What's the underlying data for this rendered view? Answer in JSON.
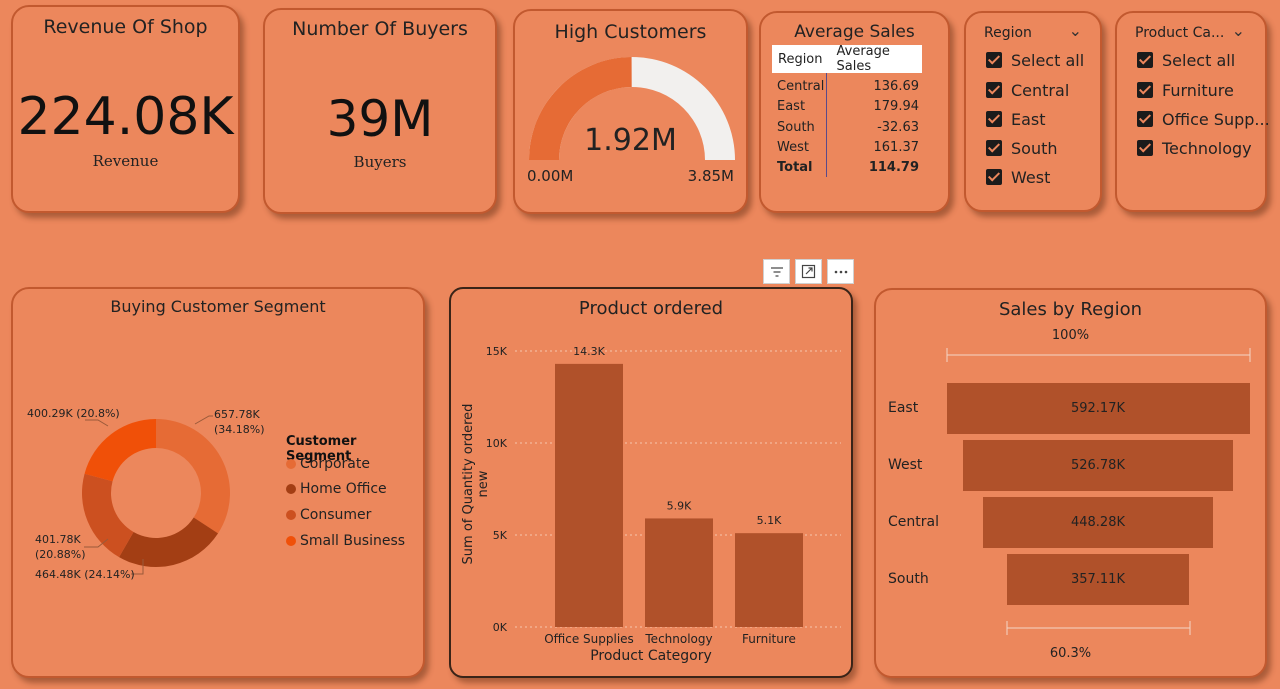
{
  "revenue_card": {
    "title": "Revenue Of Shop",
    "value": "224.08K",
    "label": "Revenue"
  },
  "buyers_card": {
    "title": "Number Of Buyers",
    "value": "39M",
    "label": "Buyers"
  },
  "gauge_card": {
    "title": "High Customers",
    "value": "1.92M",
    "min_label": "0.00M",
    "max_label": "3.85M",
    "value_num": 1.92,
    "max_num": 3.85
  },
  "avg_sales": {
    "title": "Average Sales",
    "col_region": "Region",
    "col_avg": "Average Sales",
    "rows": [
      {
        "region": "Central",
        "value": "136.69"
      },
      {
        "region": "East",
        "value": "179.94"
      },
      {
        "region": "South",
        "value": "-32.63"
      },
      {
        "region": "West",
        "value": "161.37"
      }
    ],
    "total_label": "Total",
    "total_value": "114.79"
  },
  "region_slicer": {
    "title": "Region",
    "items": [
      "Select all",
      "Central",
      "East",
      "South",
      "West"
    ]
  },
  "category_slicer": {
    "title": "Product Ca...",
    "items": [
      "Select all",
      "Furniture",
      "Office Supp...",
      "Technology"
    ]
  },
  "toolbar": {
    "filter_icon": "filter-icon",
    "focus_icon": "focus-mode-icon",
    "more_icon": "more-options-icon"
  },
  "segment_chart": {
    "title": "Buying Customer Segment",
    "legend_title": "Customer Segment",
    "legend": [
      {
        "name": "Corporate",
        "color": "#E66B35"
      },
      {
        "name": "Home Office",
        "color": "#A33E14"
      },
      {
        "name": "Consumer",
        "color": "#CC5020"
      },
      {
        "name": "Small Business",
        "color": "#F05008"
      }
    ],
    "labels": {
      "corporate_1": "657.78K",
      "corporate_2": "(34.18%)",
      "home_office": "464.48K (24.14%)",
      "consumer_1": "401.78K",
      "consumer_2": "(20.88%)",
      "small_business": "400.29K (20.8%)"
    }
  },
  "chart_data": [
    {
      "type": "pie",
      "title": "Buying Customer Segment",
      "categories": [
        "Corporate",
        "Home Office",
        "Consumer",
        "Small Business"
      ],
      "values": [
        657.78,
        464.48,
        401.78,
        400.29
      ],
      "percent": [
        34.18,
        24.14,
        20.88,
        20.8
      ],
      "legend": "right"
    },
    {
      "type": "bar",
      "title": "Product ordered",
      "categories": [
        "Office Supplies",
        "Technology",
        "Furniture"
      ],
      "values": [
        14300,
        5900,
        5100
      ],
      "data_labels": [
        "14.3K",
        "5.9K",
        "5.1K"
      ],
      "xlabel": "Product Category",
      "ylabel": "Sum of Quantity ordered new",
      "ylim": [
        0,
        15000
      ],
      "yticks": [
        "0K",
        "5K",
        "10K",
        "15K"
      ],
      "grid": true
    },
    {
      "type": "bar",
      "title": "Sales by Region",
      "categories": [
        "East",
        "West",
        "Central",
        "South"
      ],
      "values": [
        592.17,
        526.78,
        448.28,
        357.11
      ],
      "data_labels": [
        "592.17K",
        "526.78K",
        "448.28K",
        "357.11K"
      ],
      "top_percent": "100%",
      "bottom_percent": "60.3%"
    }
  ]
}
